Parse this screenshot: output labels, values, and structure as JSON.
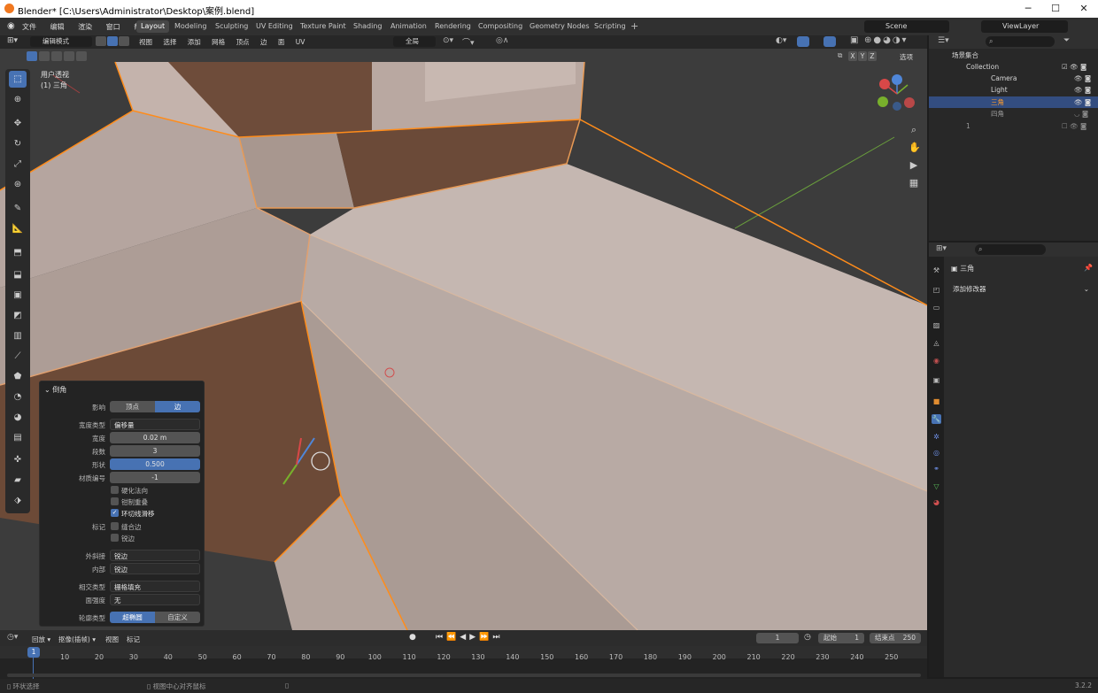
{
  "window": {
    "title": "Blender* [C:\\Users\\Administrator\\Desktop\\案例.blend]"
  },
  "menu": [
    "文件",
    "编辑",
    "渲染",
    "窗口",
    "帮助"
  ],
  "workspaces": [
    "Layout",
    "Modeling",
    "Sculpting",
    "UV Editing",
    "Texture Paint",
    "Shading",
    "Animation",
    "Rendering",
    "Compositing",
    "Geometry Nodes",
    "Scripting"
  ],
  "active_workspace": "Layout",
  "scene": "Scene",
  "view_layer": "ViewLayer",
  "header": {
    "mode": "编辑模式",
    "view_menus": [
      "视图",
      "选择",
      "添加",
      "网格",
      "顶点",
      "边",
      "面",
      "UV"
    ],
    "transform_orientation": "全局",
    "axis_x": "X",
    "axis_y": "Y",
    "axis_z": "Z",
    "options": "选项"
  },
  "viewport": {
    "view_name": "用户透视",
    "object_label": "(1) 三角"
  },
  "bevel_panel": {
    "title": "倒角",
    "affect_label": "影响",
    "affect_options": [
      "顶点",
      "边"
    ],
    "affect_selected": "边",
    "width_type_label": "宽度类型",
    "width_type": "偏移量",
    "width_label": "宽度",
    "width": "0.02 m",
    "segments_label": "段数",
    "segments": "3",
    "shape_label": "形状",
    "shape": "0.500",
    "material_label": "材质编号",
    "material": "-1",
    "harden_normals": "硬化法向",
    "clamp_overlap": "钳制重叠",
    "loop_slide": "环切线滑移",
    "mark_label": "标记",
    "mark_seam": "缝合边",
    "mark_sharp": "锐边",
    "miter_outer_label": "外斜接",
    "miter_outer": "锐边",
    "miter_inner_label": "内部",
    "miter_inner": "锐边",
    "intersection_label": "相交类型",
    "intersection": "栅格填充",
    "face_strength_label": "面强度",
    "face_strength": "无",
    "profile_label": "轮廓类型",
    "profile_options": [
      "超椭圆",
      "自定义"
    ]
  },
  "outliner": {
    "scene_collection": "场景集合",
    "items": [
      {
        "name": "Collection"
      },
      {
        "name": "Camera"
      },
      {
        "name": "Light"
      },
      {
        "name": "三角"
      },
      {
        "name": "四角"
      },
      {
        "name": "1"
      }
    ]
  },
  "properties": {
    "object_name": "三角",
    "add_modifier": "添加修改器"
  },
  "timeline": {
    "playback": "回放",
    "keying": "抠像(插帧)",
    "view": "视图",
    "marker": "标记",
    "current_frame": "1",
    "start_label": "起始",
    "start": "1",
    "end_label": "结束点",
    "end": "250",
    "ticks": [
      "1",
      "10",
      "20",
      "30",
      "40",
      "50",
      "60",
      "70",
      "80",
      "90",
      "100",
      "110",
      "120",
      "130",
      "140",
      "150",
      "160",
      "170",
      "180",
      "190",
      "200",
      "210",
      "220",
      "230",
      "240",
      "250"
    ]
  },
  "status": {
    "left": "环状选择",
    "center": "视图中心对齐鼠标",
    "version": "3.2.2"
  },
  "colors": {
    "accent": "#4772b3",
    "select_orange": "#ff8c1a",
    "face": "#c7b5ad",
    "face_dark": "#6b4a3a"
  }
}
